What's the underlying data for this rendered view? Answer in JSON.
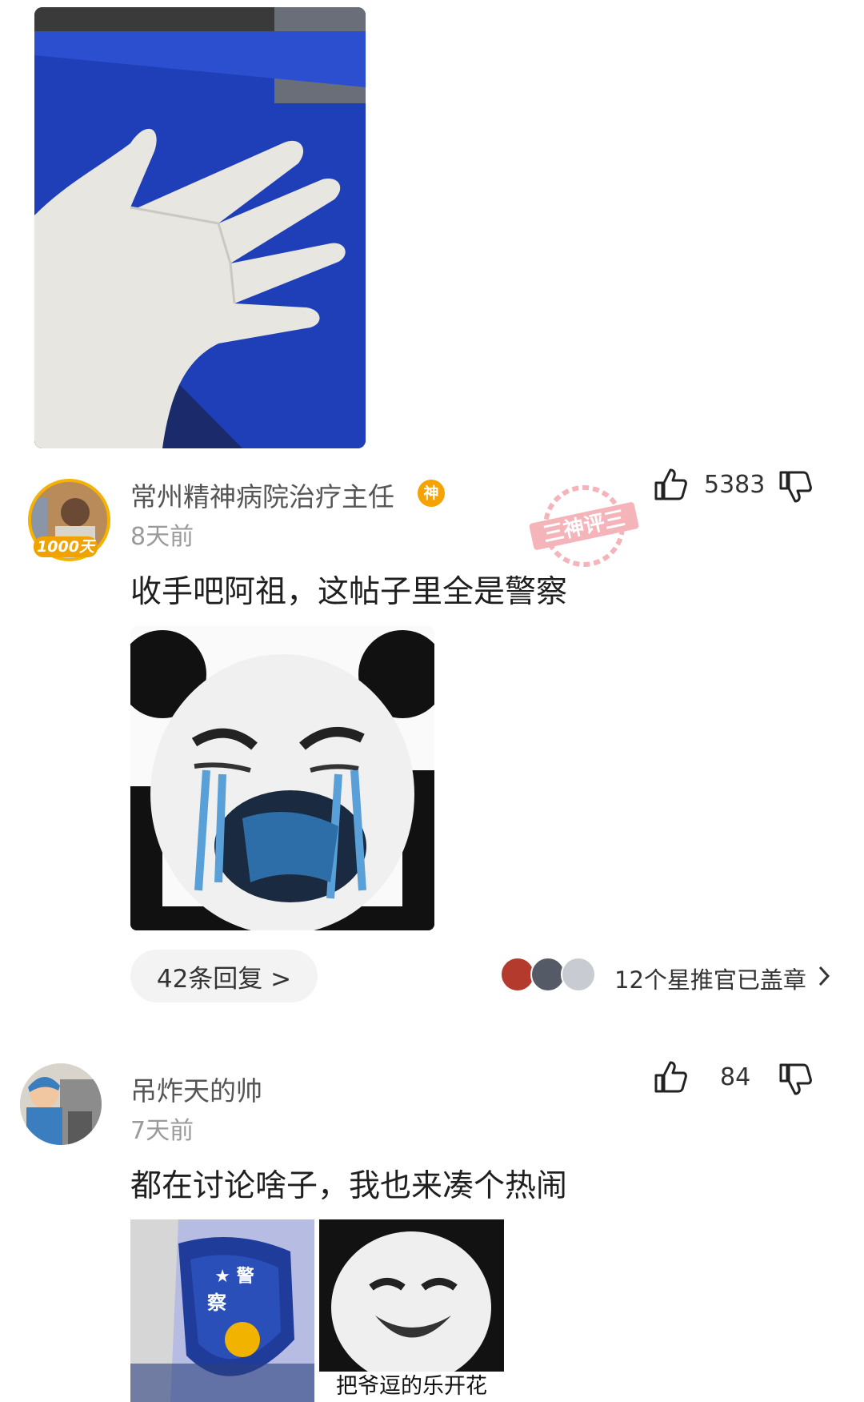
{
  "comments": [
    {
      "username": "常州精神病院治疗主任",
      "badge_text": "神",
      "avatar_badge": "1000天",
      "time": "8天前",
      "like_count": "5383",
      "text": "收手吧阿祖，这帖子里全是警察",
      "stamp_text": "神评",
      "reply_label": "42条回复 >",
      "star_label": "12个星推官已盖章"
    },
    {
      "username": "吊炸天的帅",
      "time": "7天前",
      "like_count": "84",
      "text": "都在讨论啥子，我也来凑个热闹",
      "meme_caption": "把爷逗的乐开花"
    }
  ],
  "colors": {
    "accent": "#e85a66",
    "badge_gold": "#f4a300",
    "glove_bg": "#1d3fbf"
  }
}
